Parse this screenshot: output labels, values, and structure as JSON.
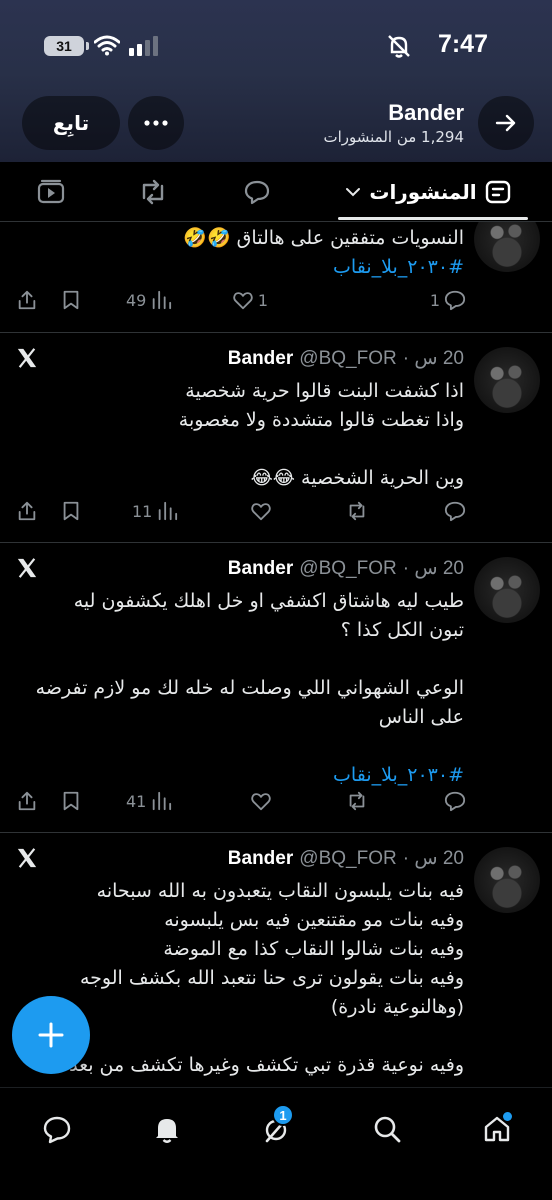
{
  "status_bar": {
    "time": "7:47",
    "battery": "31"
  },
  "profile": {
    "name": "Bander",
    "post_count": "1,294 من المنشورات",
    "follow_label": "تابِع"
  },
  "tabs": {
    "posts": "المنشورات"
  },
  "posts": [
    {
      "lines": [
        "النسويات متفقين على هالتاق 🤣🤣",
        "#٢٠٣٠_بلا_نقاب"
      ],
      "replies": "1",
      "likes": "1",
      "views": "49"
    },
    {
      "name": "Bander",
      "handle": "@BQ_FOR",
      "time": "20 س",
      "lines": [
        "اذا كشفت البنت قالوا حرية شخصية",
        "واذا تغطت قالوا متشددة ولا مغصوبة",
        "",
        "وين الحرية الشخصية 😂😂"
      ],
      "views": "11"
    },
    {
      "name": "Bander",
      "handle": "@BQ_FOR",
      "time": "20 س",
      "lines": [
        "طيب ليه هاشتاق اكشفي او خل اهلك يكشفون ليه",
        "تبون الكل كذا ؟",
        "",
        "الوعي الشهواني اللي وصلت له خله لك مو لازم تفرضه",
        "على الناس",
        "",
        "#٢٠٣٠_بلا_نقاب"
      ],
      "views": "41"
    },
    {
      "name": "Bander",
      "handle": "@BQ_FOR",
      "time": "20 س",
      "lines": [
        "فيه بنات يلبسون النقاب يتعبدون به الله سبحانه",
        "وفيه بنات مو مقتنعين فيه بس يلبسونه",
        "وفيه بنات شالوا النقاب كذا مع الموضة",
        "وفيه بنات يقولون ترى حنا نتعبد الله بكشف الوجه",
        "(وهالنوعية نادرة)",
        "",
        "وفيه نوعية قذرة تبي تكشف وغيرها تكشف من بعد"
      ]
    }
  ],
  "nav": {
    "notification_badge": "1"
  },
  "colors": {
    "accent": "#1d9bf0",
    "background": "#000000",
    "header_gradient_top": "#2c3350"
  }
}
